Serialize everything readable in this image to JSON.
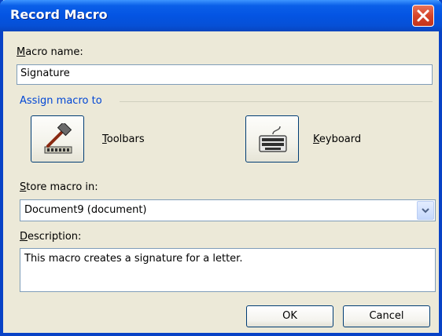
{
  "window": {
    "title": "Record Macro"
  },
  "macro_name": {
    "label_key": "M",
    "label_rest": "acro name:",
    "value": "Signature"
  },
  "assign": {
    "group_label": "Assign macro to",
    "toolbars": {
      "label_key": "T",
      "label_rest": "oolbars",
      "icon": "hammer-toolbar-icon"
    },
    "keyboard": {
      "label_key": "K",
      "label_rest": "eyboard",
      "icon": "keyboard-icon"
    }
  },
  "store": {
    "label_key": "S",
    "label_rest": "tore macro in:",
    "selected": "Document9 (document)"
  },
  "description": {
    "label_key": "D",
    "label_rest": "escription:",
    "value": "This macro creates a signature for a letter."
  },
  "buttons": {
    "ok": "OK",
    "cancel": "Cancel"
  },
  "colors": {
    "titlebar": "#0454e3",
    "dialog_bg": "#ece9d8",
    "group_label": "#0046d5",
    "close_button": "#d6452a"
  }
}
